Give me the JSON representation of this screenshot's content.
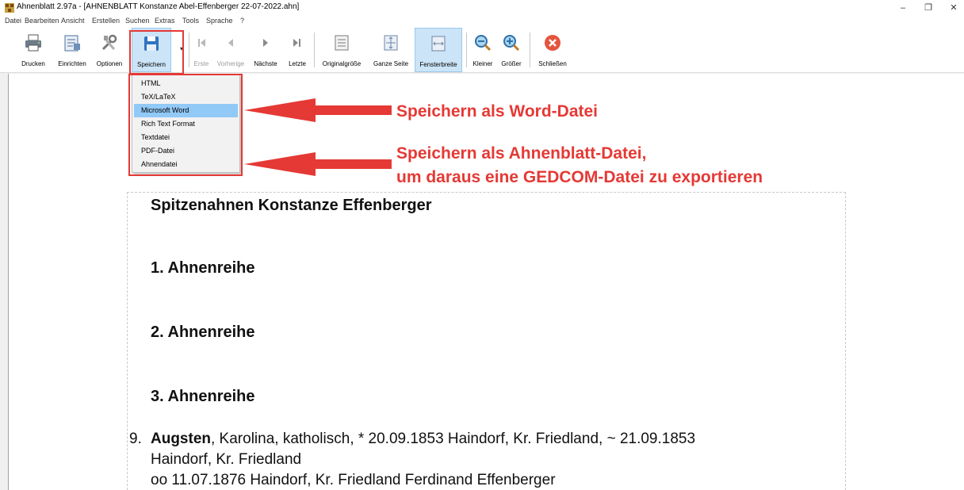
{
  "window": {
    "title": "Ahnenblatt 2.97a - [AHNENBLATT Konstanze Abel-Effenberger 22-07-2022.ahn]",
    "controls": {
      "minimize": "–",
      "maximize": "❐",
      "close": "✕"
    }
  },
  "menu": [
    "Datei",
    "Bearbeiten",
    "Ansicht",
    "Erstellen",
    "Suchen",
    "Extras",
    "Tools",
    "Sprache",
    "?"
  ],
  "toolbar": {
    "print": "Drucken",
    "setup": "Einrichten",
    "options": "Optionen",
    "save": "Speichern",
    "first": "Erste",
    "previous": "Vorherige",
    "next": "Nächste",
    "last": "Letzte",
    "original_size": "Originalgröße",
    "full_page": "Ganze Seite",
    "window_width": "Fensterbreite",
    "smaller": "Kleiner",
    "bigger": "Größer",
    "close": "Schließen"
  },
  "save_menu": {
    "items": [
      "HTML",
      "TeX/LaTeX",
      "Microsoft Word",
      "Rich Text Format",
      "Textdatei",
      "PDF-Datei",
      "Ahnendatei"
    ],
    "selected": "Microsoft Word"
  },
  "annotations": {
    "word": "Speichern als Word-Datei",
    "ahnen_line1": "Speichern als Ahnenblatt-Datei,",
    "ahnen_line2": "um daraus eine GEDCOM-Datei zu exportieren"
  },
  "document": {
    "title": "Spitzenahnen Konstanze Effenberger",
    "sections": [
      "1. Ahnenreihe",
      "2. Ahnenreihe",
      "3. Ahnenreihe"
    ],
    "entry": {
      "number": "9.",
      "surname": "Augsten",
      "line1_rest": ", Karolina, katholisch, * 20.09.1853 Haindorf, Kr. Friedland, ~ 21.09.1853",
      "line2": "Haindorf, Kr. Friedland",
      "line3": "oo 11.07.1876 Haindorf, Kr. Friedland Ferdinand Effenberger"
    }
  },
  "colors": {
    "highlight_red": "#e53935",
    "menu_selection": "#91c9f7",
    "pressed_button": "#cce4f7"
  }
}
